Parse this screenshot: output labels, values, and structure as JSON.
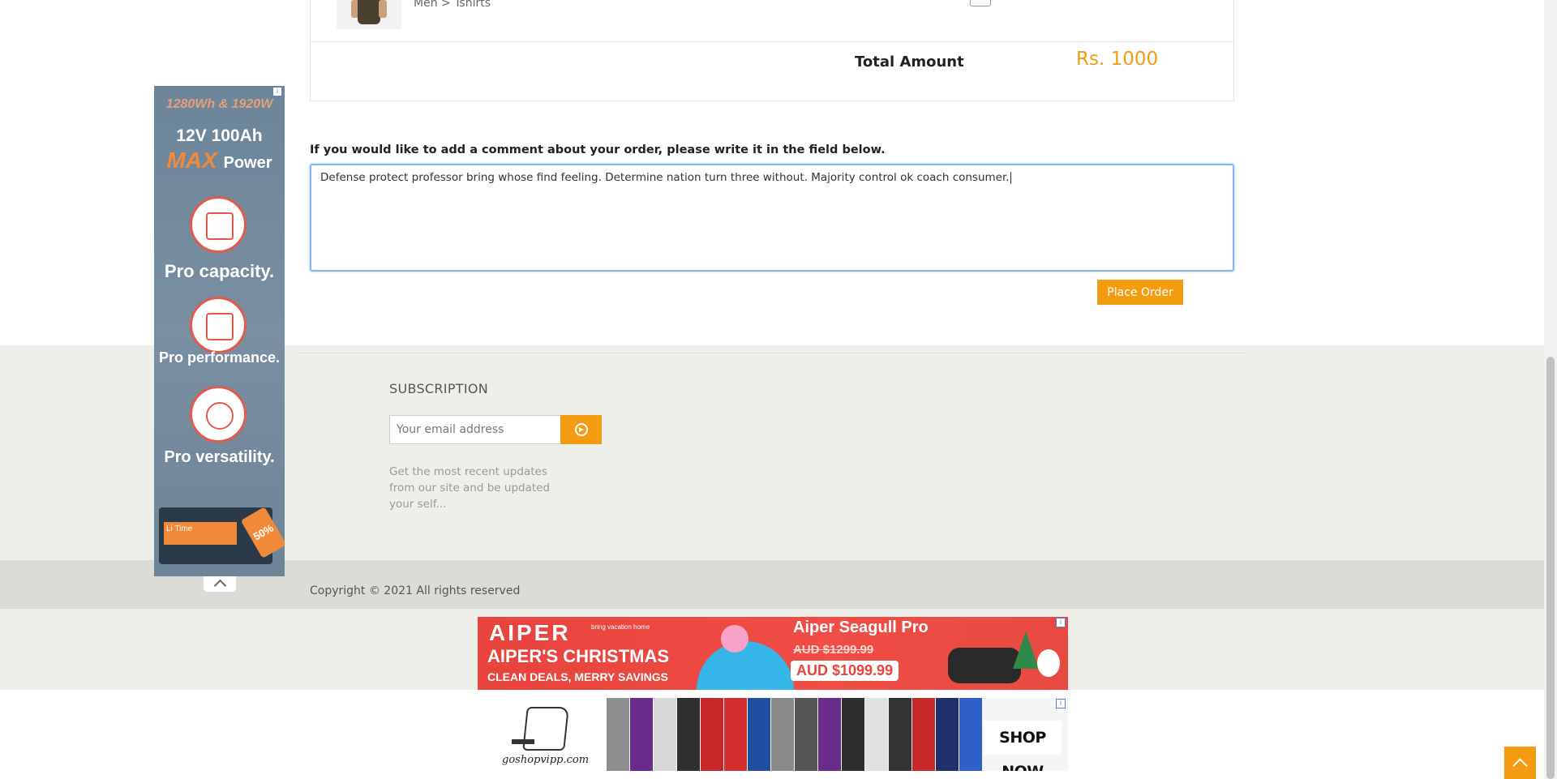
{
  "order": {
    "category_path": "Men > Tshirts",
    "total_label": "Total Amount",
    "total_value": "Rs. 1000"
  },
  "comment": {
    "prompt": "If you would like to add a comment about your order, please write it in the field below.",
    "value": "Defense protect professor bring whose find feeling. Determine nation turn three without. Majority control ok coach consumer."
  },
  "actions": {
    "place_order_label": "Place Order"
  },
  "footer": {
    "subscription_title": "SUBSCRIPTION",
    "email_placeholder": "Your email address",
    "subscription_desc": "Get the most recent updates from our site and be updated your self...",
    "copyright": "Copyright © 2021 All rights reserved"
  },
  "ads": {
    "sky": {
      "headline_1": "1280Wh & 1920W",
      "headline_2": "12V 100Ah",
      "headline_max": "MAX",
      "headline_power": "Power",
      "feature_1": "Pro capacity.",
      "feature_2": "Pro performance.",
      "feature_3": "Pro versatility.",
      "battery_brand": "Li Time",
      "tag": "50%"
    },
    "aiper": {
      "brand": "AIPER",
      "brand_sub": "bring vacation home",
      "headline": "AIPER'S CHRISTMAS",
      "subline": "CLEAN DEALS, MERRY SAVINGS",
      "product": "Aiper Seagull Pro",
      "old_price": "AUD $1299.99",
      "new_price": "AUD $1099.99"
    },
    "goshop": {
      "logo_text": "goshopvipp.com",
      "cta": "SHOP NOW"
    },
    "ad_marker": "i"
  },
  "colors": {
    "accent": "#f39c12",
    "footer_bg": "#efefe9",
    "copyright_bg": "#dcdcd6"
  }
}
